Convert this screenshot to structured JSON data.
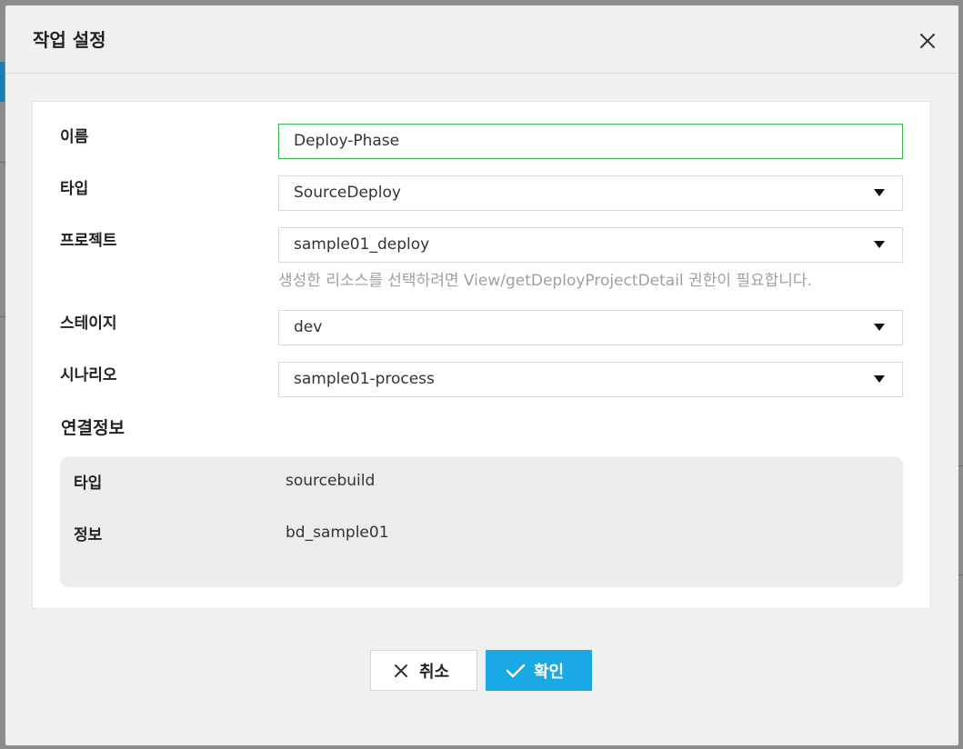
{
  "modal": {
    "title": "작업 설정"
  },
  "form": {
    "name": {
      "label": "이름",
      "value": "Deploy-Phase"
    },
    "type": {
      "label": "타입",
      "value": "SourceDeploy"
    },
    "project": {
      "label": "프로젝트",
      "value": "sample01_deploy",
      "hint": "생성한 리소스를 선택하려면 View/getDeployProjectDetail 권한이 필요합니다."
    },
    "stage": {
      "label": "스테이지",
      "value": "dev"
    },
    "scenario": {
      "label": "시나리오",
      "value": "sample01-process"
    }
  },
  "connection": {
    "title": "연결정보",
    "rows": [
      {
        "label": "타입",
        "value": "sourcebuild"
      },
      {
        "label": "정보",
        "value": "bd_sample01"
      }
    ]
  },
  "footer": {
    "cancel_label": "취소",
    "ok_label": "확인"
  },
  "colors": {
    "accent": "#1ba9e6",
    "active_border": "#3cb54a",
    "hint": "#a0a0a0"
  },
  "icons": {
    "close": "close-icon",
    "dropdown": "caret-down-icon",
    "cancel": "x-icon",
    "ok": "check-icon"
  }
}
